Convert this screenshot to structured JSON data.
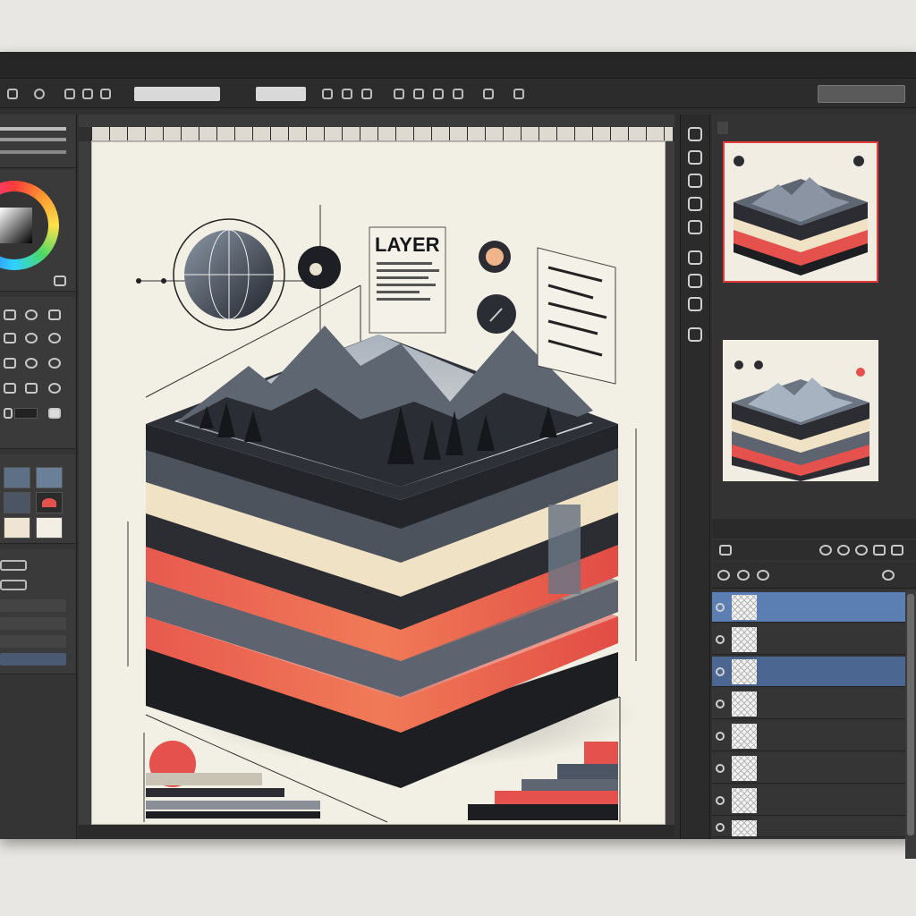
{
  "menubar": {
    "items": [
      "",
      "",
      "",
      "",
      "",
      "",
      "",
      "",
      "",
      "",
      ""
    ]
  },
  "optionsbar": {
    "field1": "",
    "field2": "",
    "button_label": ""
  },
  "document": {
    "tab_label": "",
    "heading": "LAYER",
    "status_text": ""
  },
  "right_panel": {
    "preview_tab": "",
    "layers_tabs": [
      "",
      "",
      ""
    ]
  },
  "layers": [
    {
      "name": "",
      "state": "selected"
    },
    {
      "name": "",
      "state": "normal"
    },
    {
      "name": "",
      "state": "mid"
    },
    {
      "name": "",
      "state": "normal"
    },
    {
      "name": "",
      "state": "normal"
    },
    {
      "name": "",
      "state": "normal"
    },
    {
      "name": "",
      "state": "normal"
    },
    {
      "name": "",
      "state": "normal"
    }
  ],
  "colors": {
    "accent_red": "#e5514c",
    "dark_layer": "#2b2d33",
    "slate_layer": "#5e6570",
    "cream_layer": "#f0e2c4",
    "selection_blue": "#5b7fb2",
    "app_background": "#2f2f2f"
  },
  "icons": [
    "globe-icon",
    "eye-icon",
    "pin-icon",
    "brush-icon",
    "color-wheel-icon",
    "layer-thumbnail-icon"
  ]
}
